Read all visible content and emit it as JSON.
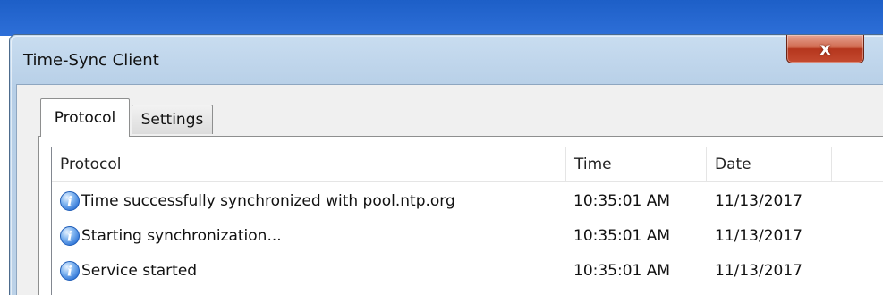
{
  "window": {
    "title": "Time-Sync Client",
    "close_label": "x"
  },
  "tabs": [
    {
      "label": "Protocol",
      "active": true
    },
    {
      "label": "Settings",
      "active": false
    }
  ],
  "list": {
    "columns": [
      "Protocol",
      "Time",
      "Date"
    ],
    "rows": [
      {
        "icon": "info-icon",
        "message": "Time successfully synchronized with pool.ntp.org",
        "time": "10:35:01 AM",
        "date": "11/13/2017"
      },
      {
        "icon": "info-icon",
        "message": "Starting synchronization...",
        "time": "10:35:01 AM",
        "date": "11/13/2017"
      },
      {
        "icon": "info-icon",
        "message": "Service started",
        "time": "10:35:01 AM",
        "date": "11/13/2017"
      }
    ]
  },
  "colors": {
    "desktop": "#1d5fc7",
    "frame": "#bcd2e8",
    "close_button": "#c44a30",
    "info_icon": "#2d73d6"
  }
}
